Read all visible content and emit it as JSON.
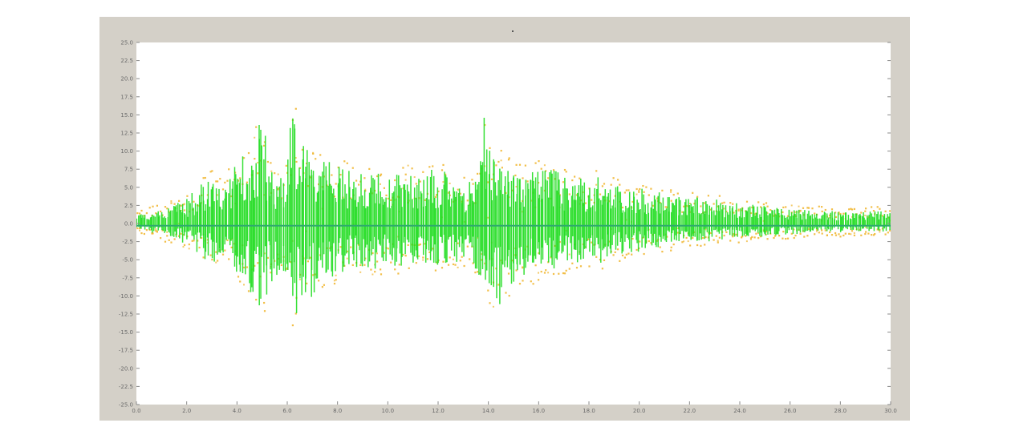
{
  "chart_data": {
    "type": "line",
    "title": "",
    "xlabel": "",
    "ylabel": "",
    "grid": false,
    "legend": "none",
    "ylim": [
      -25,
      25
    ],
    "xlim": [
      0,
      30
    ],
    "y_ticks": [
      25,
      22.5,
      20,
      17.5,
      15,
      12.5,
      10,
      7.5,
      5,
      2.5,
      0,
      -2.5,
      -5,
      -7.5,
      -10,
      -12.5,
      -15,
      -17.5,
      -20,
      -22.5,
      -25
    ],
    "x_ticks": [
      0,
      2,
      4,
      6,
      8,
      10,
      12,
      14,
      16,
      18,
      20,
      22,
      24,
      26,
      28,
      30
    ],
    "series": [
      {
        "color": "#22dd22",
        "style": "line",
        "x": [
          0,
          0.5,
          1,
          1.5,
          2,
          2.5,
          3,
          3.5,
          4,
          4.5,
          5,
          5.5,
          6,
          6.2,
          6.5,
          7,
          7.5,
          8,
          8.5,
          9,
          9.5,
          10,
          10.5,
          11,
          11.5,
          12,
          12.5,
          13,
          13.5,
          13.8,
          14,
          14.5,
          15,
          15.5,
          16,
          16.5,
          17,
          17.5,
          18,
          18.5,
          19,
          19.5,
          20,
          20.5,
          21,
          21.5,
          22,
          22.5,
          23,
          23.5,
          24,
          24.5,
          25,
          25.5,
          26,
          26.5,
          27,
          27.5,
          28,
          28.5,
          29,
          29.5,
          30
        ],
        "upper": [
          1.2,
          1.5,
          2.0,
          2.8,
          3.5,
          5.2,
          6.8,
          5.5,
          8.5,
          11.0,
          14.5,
          6.5,
          9.5,
          17.5,
          12.0,
          10.0,
          9.0,
          8.0,
          7.5,
          7.0,
          7.2,
          6.5,
          7.5,
          7.0,
          6.5,
          8.5,
          6.0,
          5.5,
          6.5,
          17.0,
          12.0,
          9.5,
          8.0,
          7.5,
          8.0,
          7.5,
          7.0,
          6.5,
          6.0,
          7.0,
          5.5,
          5.0,
          5.5,
          4.5,
          4.2,
          4.0,
          3.8,
          3.6,
          3.4,
          3.0,
          2.8,
          2.6,
          2.4,
          2.2,
          2.0,
          2.0,
          1.8,
          1.8,
          1.6,
          1.5,
          1.6,
          1.8,
          1.5
        ],
        "lower": [
          -0.8,
          -1.2,
          -1.5,
          -2.2,
          -3.0,
          -4.5,
          -5.5,
          -4.5,
          -7.0,
          -9.5,
          -12.5,
          -7.0,
          -8.5,
          -13.5,
          -12.0,
          -10.0,
          -9.0,
          -7.0,
          -6.5,
          -6.0,
          -6.5,
          -5.5,
          -6.5,
          -6.0,
          -5.5,
          -6.5,
          -5.0,
          -6.0,
          -7.0,
          -9.0,
          -10.5,
          -11.5,
          -9.0,
          -8.0,
          -7.0,
          -6.5,
          -6.0,
          -5.5,
          -5.0,
          -5.5,
          -4.5,
          -4.0,
          -4.0,
          -3.5,
          -3.2,
          -3.0,
          -2.8,
          -2.6,
          -2.4,
          -2.2,
          -2.0,
          -1.9,
          -1.8,
          -1.6,
          -1.5,
          -1.4,
          -1.3,
          -1.2,
          -1.2,
          -1.1,
          -1.1,
          -1.2,
          -1.0
        ]
      },
      {
        "color": "#f0b429",
        "style": "markers",
        "x": [
          0,
          0.5,
          1,
          1.5,
          2,
          2.5,
          3,
          3.5,
          4,
          4.5,
          5,
          5.5,
          6,
          6.2,
          6.5,
          7,
          7.5,
          8,
          8.5,
          9,
          9.5,
          10,
          10.5,
          11,
          11.5,
          12,
          12.5,
          13,
          13.5,
          13.8,
          14,
          14.5,
          15,
          15.5,
          16,
          16.5,
          17,
          17.5,
          18,
          18.5,
          19,
          19.5,
          20,
          20.5,
          21,
          21.5,
          22,
          22.5,
          23,
          23.5,
          24,
          24.5,
          25,
          25.5,
          26,
          26.5,
          27,
          27.5,
          28,
          28.5,
          29,
          29.5,
          30
        ],
        "upper": [
          2.0,
          2.2,
          2.8,
          3.5,
          4.2,
          6.0,
          7.8,
          6.5,
          9.5,
          12.0,
          15.5,
          7.5,
          10.5,
          18.5,
          13.0,
          11.0,
          10.0,
          9.0,
          8.5,
          8.0,
          8.2,
          7.5,
          8.5,
          8.0,
          7.5,
          9.5,
          7.0,
          6.5,
          7.5,
          18.0,
          13.0,
          10.5,
          9.0,
          8.5,
          9.0,
          8.5,
          8.0,
          7.5,
          7.0,
          8.0,
          6.5,
          6.0,
          6.2,
          5.2,
          4.9,
          4.6,
          4.4,
          4.2,
          4.0,
          3.6,
          3.4,
          3.2,
          3.0,
          2.8,
          2.6,
          2.6,
          2.4,
          2.4,
          2.2,
          2.1,
          2.2,
          2.4,
          2.1
        ],
        "lower": [
          -1.5,
          -2.0,
          -2.4,
          -3.0,
          -3.8,
          -5.4,
          -6.4,
          -5.4,
          -8.0,
          -10.5,
          -13.5,
          -8.0,
          -9.5,
          -14.5,
          -13.0,
          -11.0,
          -10.0,
          -8.0,
          -7.5,
          -7.0,
          -7.5,
          -6.5,
          -7.5,
          -7.0,
          -6.5,
          -7.5,
          -6.0,
          -7.0,
          -8.0,
          -10.0,
          -11.5,
          -12.5,
          -10.0,
          -9.0,
          -8.0,
          -7.5,
          -7.0,
          -6.5,
          -6.0,
          -6.5,
          -5.5,
          -5.0,
          -4.8,
          -4.2,
          -3.9,
          -3.6,
          -3.4,
          -3.2,
          -3.0,
          -2.8,
          -2.6,
          -2.5,
          -2.4,
          -2.2,
          -2.1,
          -2.0,
          -1.9,
          -1.8,
          -1.8,
          -1.7,
          -1.7,
          -1.8,
          -1.6
        ]
      },
      {
        "color": "#2eaa6e",
        "style": "baseline",
        "x": [
          0,
          30
        ],
        "values": [
          -0.3,
          -0.3
        ]
      }
    ]
  }
}
